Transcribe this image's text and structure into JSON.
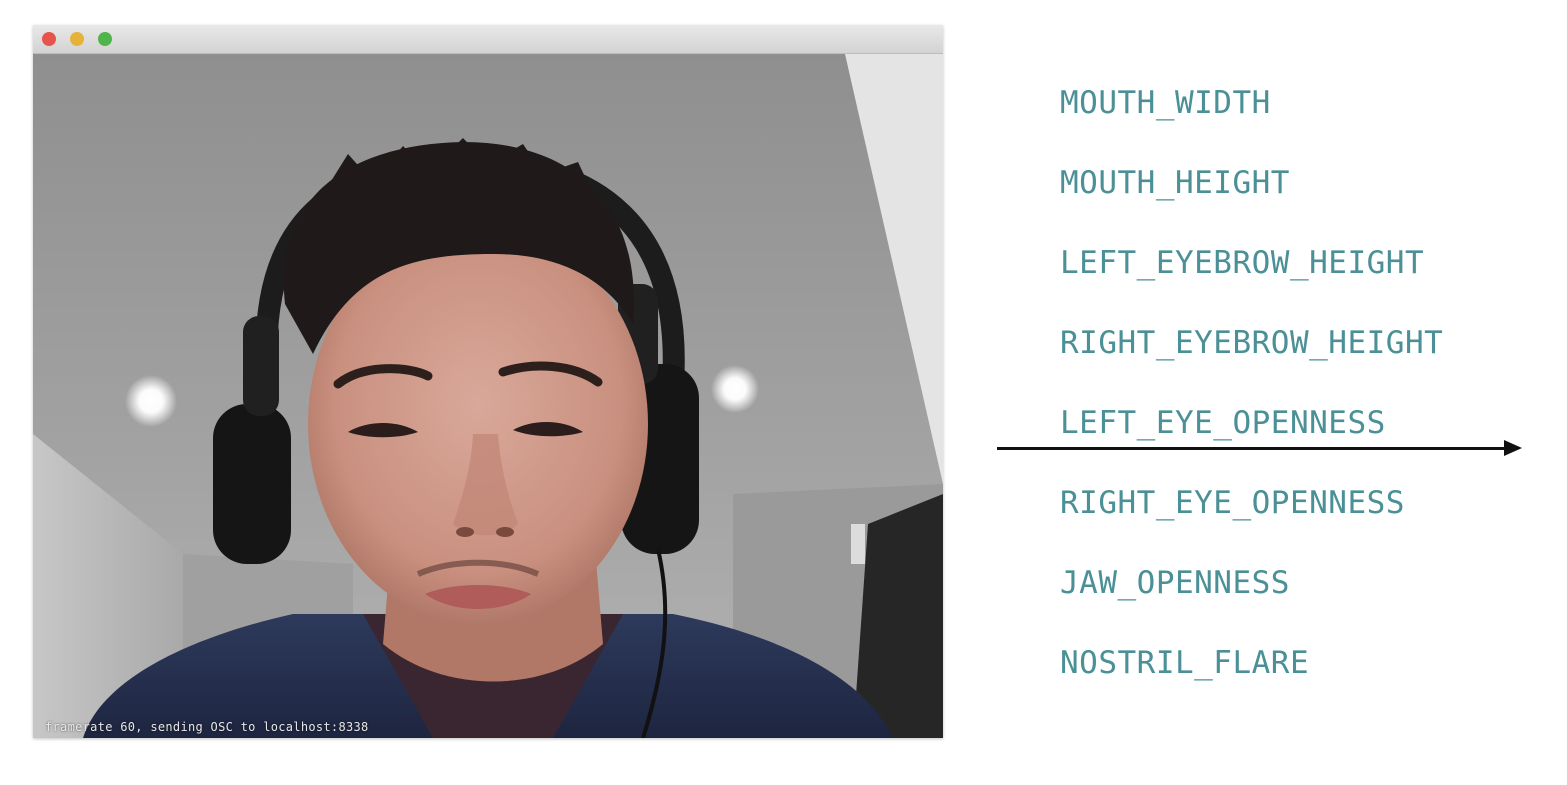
{
  "window": {
    "traffic_lights": [
      {
        "name": "close",
        "color": "#e6554c"
      },
      {
        "name": "minimize",
        "color": "#e5b33a"
      },
      {
        "name": "maximize",
        "color": "#4fb54a"
      }
    ],
    "status_text": "framerate 60, sending OSC to localhost:8338"
  },
  "features": {
    "color": "#4a9096",
    "items": [
      "MOUTH_WIDTH",
      "MOUTH_HEIGHT",
      "LEFT_EYEBROW_HEIGHT",
      "RIGHT_EYEBROW_HEIGHT",
      "LEFT_EYE_OPENNESS",
      "RIGHT_EYE_OPENNESS",
      "JAW_OPENNESS",
      "NOSTRIL_FLARE"
    ]
  },
  "arrow": {
    "icon": "arrow-right-icon",
    "color": "#111111"
  }
}
